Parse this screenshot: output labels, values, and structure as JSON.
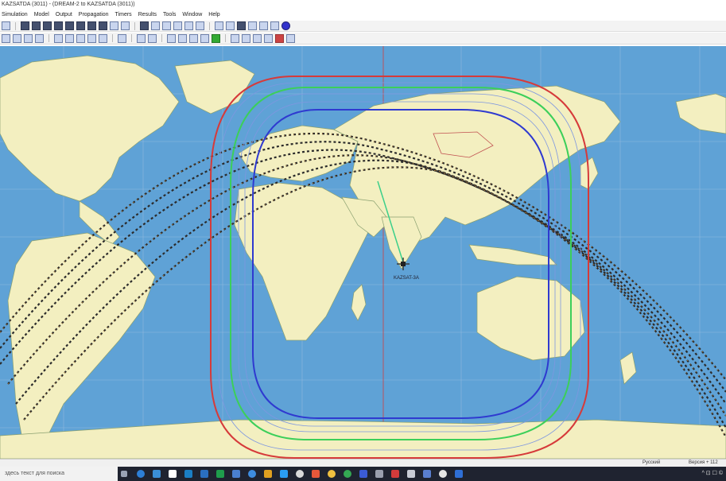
{
  "window": {
    "title": "KAZSATDA (3011) - (DREAM-2 to KAZSATDA (3011))"
  },
  "menu": {
    "items": [
      "Simulation",
      "Model",
      "Output",
      "Propagation",
      "Timers",
      "Results",
      "Tools",
      "Window",
      "Help"
    ]
  },
  "map": {
    "satellite_label": "KAZSAT-3A",
    "ocean_color": "#5fa2d6",
    "land_color": "#f3efc0",
    "contour_colors": [
      "#d63a3a",
      "#3ccf5a",
      "#2f3ad0",
      "#7e97e0"
    ]
  },
  "statusbar": {
    "left": "Русский",
    "right": "Версия + 112"
  },
  "taskbar": {
    "search_placeholder": "здесь текст для поиска",
    "tray_text": "^ ⊡ ☐ ©"
  }
}
